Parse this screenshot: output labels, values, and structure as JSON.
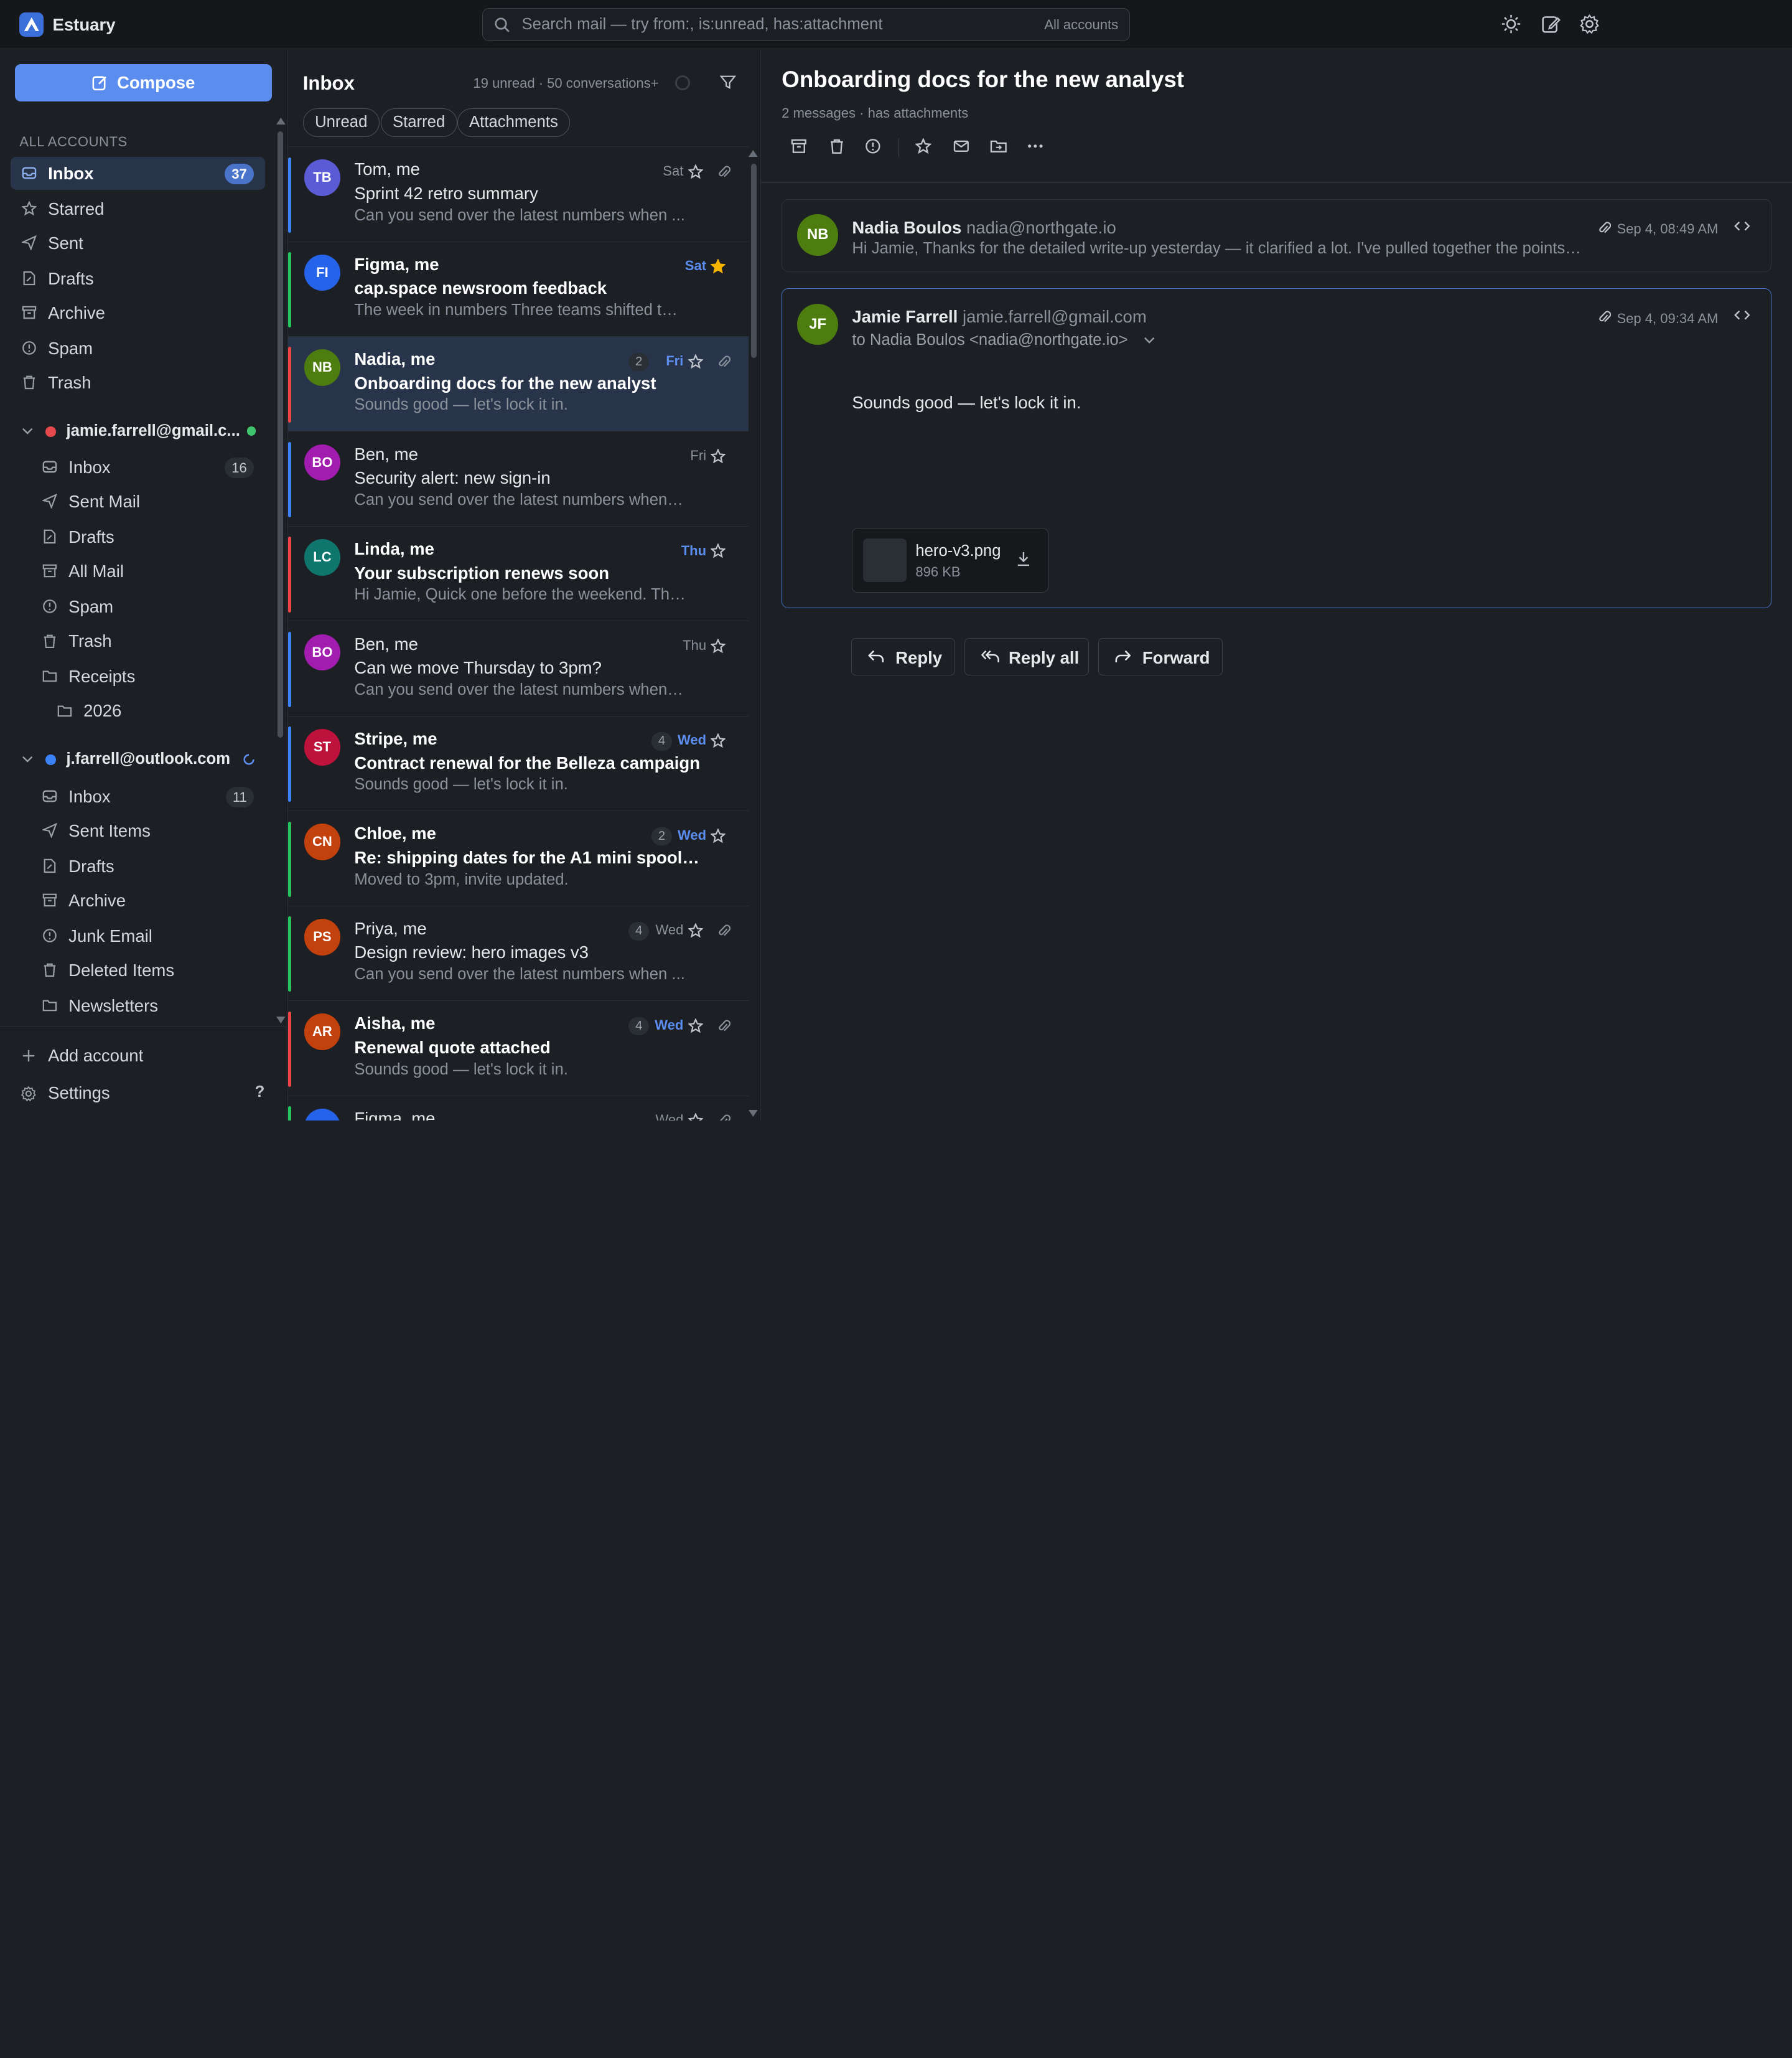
{
  "app": {
    "name": "Estuary"
  },
  "search": {
    "placeholder": "Search mail — try from:, is:unread, has:attachment",
    "scope": "All accounts"
  },
  "sidebar": {
    "compose_label": "Compose",
    "section_label": "ALL ACCOUNTS",
    "unified": [
      {
        "label": "Inbox",
        "badge": "37",
        "icon": "inbox-icon",
        "active": true
      },
      {
        "label": "Starred",
        "icon": "star-icon"
      },
      {
        "label": "Sent",
        "icon": "send-icon"
      },
      {
        "label": "Drafts",
        "icon": "draft-icon"
      },
      {
        "label": "Archive",
        "icon": "archive-icon"
      },
      {
        "label": "Spam",
        "icon": "spam-icon"
      },
      {
        "label": "Trash",
        "icon": "trash-icon"
      }
    ],
    "accounts": [
      {
        "email": "jamie.farrell@gmail.c...",
        "dot_color": "#e5484d",
        "folders": [
          {
            "label": "Inbox",
            "badge": "16",
            "icon": "inbox-icon"
          },
          {
            "label": "Sent Mail",
            "icon": "send-icon"
          },
          {
            "label": "Drafts",
            "icon": "draft-icon"
          },
          {
            "label": "All Mail",
            "icon": "archive-icon"
          },
          {
            "label": "Spam",
            "icon": "spam-icon"
          },
          {
            "label": "Trash",
            "icon": "trash-icon"
          },
          {
            "label": "Receipts",
            "icon": "folder-icon"
          },
          {
            "label": "2026",
            "icon": "folder-icon",
            "nested": true
          }
        ]
      },
      {
        "email": "j.farrell@outlook.com",
        "dot_color": "#3b82f6",
        "folders": [
          {
            "label": "Inbox",
            "badge": "11",
            "icon": "inbox-icon"
          },
          {
            "label": "Sent Items",
            "icon": "send-icon"
          },
          {
            "label": "Drafts",
            "icon": "draft-icon"
          },
          {
            "label": "Archive",
            "icon": "archive-icon"
          },
          {
            "label": "Junk Email",
            "icon": "spam-icon"
          },
          {
            "label": "Deleted Items",
            "icon": "trash-icon"
          },
          {
            "label": "Newsletters",
            "icon": "folder-icon"
          }
        ]
      }
    ],
    "footer": {
      "add_account": "Add account",
      "settings": "Settings",
      "help": "?"
    }
  },
  "list": {
    "title": "Inbox",
    "meta": "19 unread · 50 conversations+",
    "chips": [
      "Unread",
      "Starred",
      "Attachments"
    ],
    "rows": [
      {
        "initials": "TB",
        "avatar_color": "#5b5bd6",
        "bar_color": "#3b82f6",
        "from": "Tom, me",
        "subject": "Sprint 42 retro summary",
        "preview": "Can you send over the latest numbers when ...",
        "date": "Sat",
        "unread": false,
        "starred": false,
        "attachment": true,
        "count": ""
      },
      {
        "initials": "FI",
        "avatar_color": "#2563eb",
        "bar_color": "#22c55e",
        "from": "Figma, me",
        "subject": "cap.space newsroom feedback",
        "preview": "The week in numbers Three teams shifted their ...",
        "date": "Sat",
        "unread": true,
        "starred": true,
        "attachment": false,
        "count": ""
      },
      {
        "initials": "NB",
        "avatar_color": "#4d7c0f",
        "bar_color": "#ef4444",
        "from": "Nadia, me",
        "subject": "Onboarding docs for the new analyst",
        "preview": "Sounds good — let's lock it in.",
        "date": "Fri",
        "unread": true,
        "starred": false,
        "attachment": true,
        "count": "2",
        "selected": true
      },
      {
        "initials": "BO",
        "avatar_color": "#a21caf",
        "bar_color": "#3b82f6",
        "from": "Ben, me",
        "subject": "Security alert: new sign-in",
        "preview": "Can you send over the latest numbers when yo...",
        "date": "Fri",
        "unread": false,
        "starred": false,
        "attachment": false,
        "count": ""
      },
      {
        "initials": "LC",
        "avatar_color": "#0f766e",
        "bar_color": "#ef4444",
        "from": "Linda, me",
        "subject": "Your subscription renews soon",
        "preview": "Hi Jamie, Quick one before the weekend. The st...",
        "date": "Thu",
        "unread": true,
        "starred": false,
        "attachment": false,
        "count": ""
      },
      {
        "initials": "BO",
        "avatar_color": "#a21caf",
        "bar_color": "#3b82f6",
        "from": "Ben, me",
        "subject": "Can we move Thursday to 3pm?",
        "preview": "Can you send over the latest numbers when yo...",
        "date": "Thu",
        "unread": false,
        "starred": false,
        "attachment": false,
        "count": ""
      },
      {
        "initials": "ST",
        "avatar_color": "#be123c",
        "bar_color": "#3b82f6",
        "from": "Stripe, me",
        "subject": "Contract renewal for the Belleza campaign",
        "preview": "Sounds good — let's lock it in.",
        "date": "Wed",
        "unread": true,
        "starred": false,
        "attachment": false,
        "count": "4"
      },
      {
        "initials": "CN",
        "avatar_color": "#c2410c",
        "bar_color": "#22c55e",
        "from": "Chloe, me",
        "subject": "Re: shipping dates for the A1 mini spool ho...",
        "preview": "Moved to 3pm, invite updated.",
        "date": "Wed",
        "unread": true,
        "starred": false,
        "attachment": false,
        "count": "2"
      },
      {
        "initials": "PS",
        "avatar_color": "#c2410c",
        "bar_color": "#22c55e",
        "from": "Priya, me",
        "subject": "Design review: hero images v3",
        "preview": "Can you send over the latest numbers when ...",
        "date": "Wed",
        "unread": false,
        "starred": false,
        "attachment": true,
        "count": "4"
      },
      {
        "initials": "AR",
        "avatar_color": "#c2410c",
        "bar_color": "#ef4444",
        "from": "Aisha, me",
        "subject": "Renewal quote attached",
        "preview": "Sounds good — let's lock it in.",
        "date": "Wed",
        "unread": true,
        "starred": false,
        "attachment": true,
        "count": "4"
      },
      {
        "initials": "",
        "avatar_color": "#2563eb",
        "bar_color": "#22c55e",
        "from": "Figma, me",
        "subject": "",
        "preview": "",
        "date": "Wed",
        "unread": false,
        "starred": false,
        "attachment": true,
        "count": ""
      }
    ]
  },
  "reader": {
    "title": "Onboarding docs for the new analyst",
    "meta": "2 messages  · has attachments",
    "messages": [
      {
        "initials": "NB",
        "avatar_color": "#4d7c0f",
        "name": "Nadia Boulos",
        "email": "nadia@northgate.io",
        "snippet": "Hi Jamie, Thanks for the detailed write-up yesterday — it clarified a lot. I've pulled together the points w...",
        "date": "Sep 4, 08:49 AM"
      },
      {
        "initials": "JF",
        "avatar_color": "#4d7c0f",
        "name": "Jamie Farrell",
        "email": "jamie.farrell@gmail.com",
        "to": "to Nadia Boulos <nadia@northgate.io>",
        "body": "Sounds good — let's lock it in.",
        "date": "Sep 4, 09:34 AM",
        "attachment": {
          "name": "hero-v3.png",
          "size": "896 KB"
        }
      }
    ],
    "actions": {
      "reply": "Reply",
      "reply_all": "Reply all",
      "forward": "Forward"
    }
  }
}
